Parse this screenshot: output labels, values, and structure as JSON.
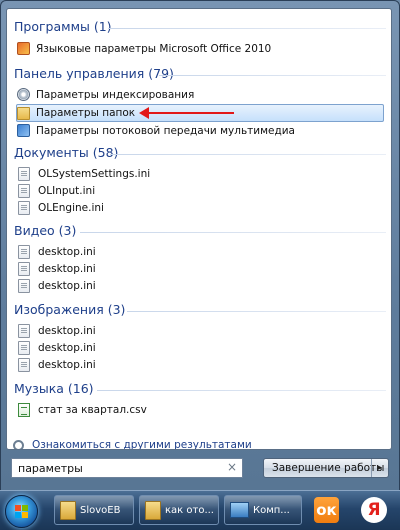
{
  "results": {
    "groups": [
      {
        "title": "Программы (1)",
        "items": [
          {
            "label": "Языковые параметры Microsoft Office 2010",
            "icon": "language-settings-icon"
          }
        ]
      },
      {
        "title": "Панель управления (79)",
        "items": [
          {
            "label": "Параметры индексирования",
            "icon": "indexing-icon"
          },
          {
            "label": "Параметры папок",
            "icon": "folder-options-icon",
            "selected": true
          },
          {
            "label": "Параметры потоковой передачи мультимедиа",
            "icon": "media-streaming-icon"
          }
        ]
      },
      {
        "title": "Документы (58)",
        "items": [
          {
            "label": "OLSystemSettings.ini",
            "icon": "ini-file-icon"
          },
          {
            "label": "OLInput.ini",
            "icon": "ini-file-icon"
          },
          {
            "label": "OLEngine.ini",
            "icon": "ini-file-icon"
          }
        ]
      },
      {
        "title": "Видео (3)",
        "items": [
          {
            "label": "desktop.ini",
            "icon": "ini-file-icon"
          },
          {
            "label": "desktop.ini",
            "icon": "ini-file-icon"
          },
          {
            "label": "desktop.ini",
            "icon": "ini-file-icon"
          }
        ]
      },
      {
        "title": "Изображения (3)",
        "items": [
          {
            "label": "desktop.ini",
            "icon": "ini-file-icon"
          },
          {
            "label": "desktop.ini",
            "icon": "ini-file-icon"
          },
          {
            "label": "desktop.ini",
            "icon": "ini-file-icon"
          }
        ]
      },
      {
        "title": "Музыка (16)",
        "items": [
          {
            "label": "стат за квартал.csv",
            "icon": "csv-file-icon"
          }
        ]
      }
    ],
    "more_results_label": "Ознакомиться с другими результатами"
  },
  "search": {
    "value": "параметры",
    "clear_glyph": "×"
  },
  "shutdown": {
    "label": "Завершение работы",
    "arrow_glyph": "▸"
  },
  "taskbar": {
    "buttons": [
      {
        "label": "SlovoEB",
        "icon": "folder-icon"
      },
      {
        "label": "как ото...",
        "icon": "folder-icon"
      },
      {
        "label": "Комп...",
        "icon": "computer-icon"
      }
    ],
    "ok_label": "ок",
    "yandex_label": "Я"
  },
  "colors": {
    "annotation_arrow": "#e21818",
    "category_text": "#1e3f8a",
    "selection_fill": "#c6e0fb"
  }
}
